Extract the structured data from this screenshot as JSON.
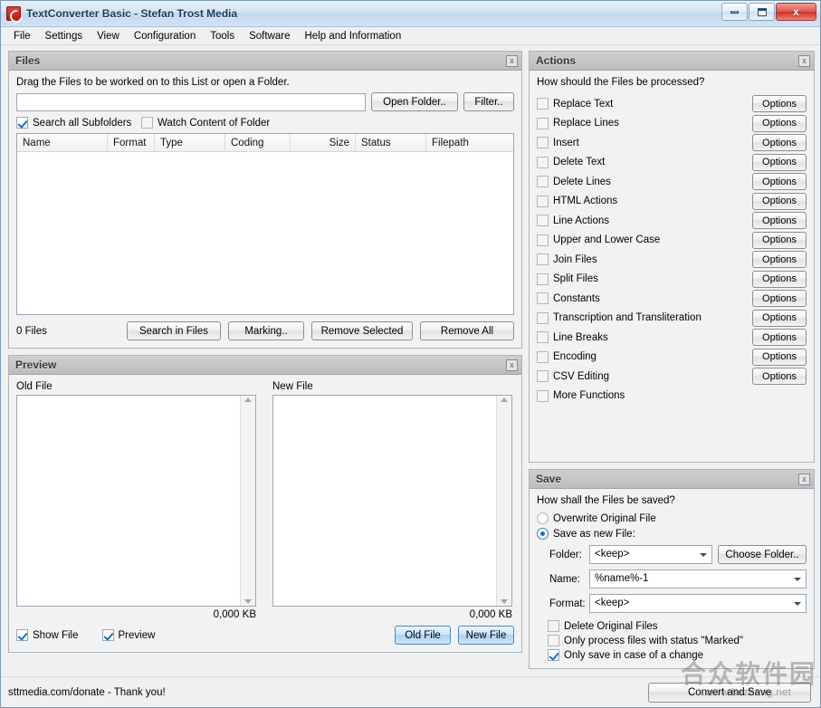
{
  "window": {
    "title": "TextConverter Basic - Stefan Trost Media",
    "app_icon": "refresh-circle-icon",
    "controls": {
      "minimize": "minimize-icon",
      "maximize": "maximize-icon",
      "close": "x"
    }
  },
  "menubar": {
    "items": [
      "File",
      "Settings",
      "View",
      "Configuration",
      "Tools",
      "Software",
      "Help and Information"
    ]
  },
  "files": {
    "title": "Files",
    "close_icon": "x",
    "hint": "Drag the Files to be worked on to this List or open a Folder.",
    "path_value": "",
    "path_placeholder": "",
    "open_folder_button": "Open Folder..",
    "filter_button": "Filter..",
    "search_subfolders": {
      "label": "Search all Subfolders",
      "checked": true
    },
    "watch_content": {
      "label": "Watch Content of Folder",
      "checked": false
    },
    "columns": [
      "Name",
      "Format",
      "Type",
      "Coding",
      "Size",
      "Status",
      "Filepath"
    ],
    "rows": [],
    "count_label": "0 Files",
    "buttons": [
      "Search in Files",
      "Marking..",
      "Remove Selected",
      "Remove All"
    ]
  },
  "preview": {
    "title": "Preview",
    "close_icon": "x",
    "old_label": "Old File",
    "new_label": "New File",
    "old_text": "",
    "new_text": "",
    "old_size": "0,000 KB",
    "new_size": "0,000 KB",
    "show_file": {
      "label": "Show File",
      "checked": true
    },
    "preview_toggle": {
      "label": "Preview",
      "checked": true
    },
    "old_file_button": "Old File",
    "new_file_button": "New File"
  },
  "actions": {
    "title": "Actions",
    "close_icon": "x",
    "hint": "How should the Files be processed?",
    "options_label": "Options",
    "items": [
      {
        "label": "Replace Text",
        "checked": false,
        "has_options": true
      },
      {
        "label": "Replace Lines",
        "checked": false,
        "has_options": true
      },
      {
        "label": "Insert",
        "checked": false,
        "has_options": true
      },
      {
        "label": "Delete Text",
        "checked": false,
        "has_options": true
      },
      {
        "label": "Delete Lines",
        "checked": false,
        "has_options": true
      },
      {
        "label": "HTML Actions",
        "checked": false,
        "has_options": true
      },
      {
        "label": "Line Actions",
        "checked": false,
        "has_options": true
      },
      {
        "label": "Upper and Lower Case",
        "checked": false,
        "has_options": true
      },
      {
        "label": "Join Files",
        "checked": false,
        "has_options": true
      },
      {
        "label": "Split Files",
        "checked": false,
        "has_options": true
      },
      {
        "label": "Constants",
        "checked": false,
        "has_options": true
      },
      {
        "label": "Transcription and Transliteration",
        "checked": false,
        "has_options": true
      },
      {
        "label": "Line Breaks",
        "checked": false,
        "has_options": true
      },
      {
        "label": "Encoding",
        "checked": false,
        "has_options": true
      },
      {
        "label": "CSV Editing",
        "checked": false,
        "has_options": true
      },
      {
        "label": "More Functions",
        "checked": false,
        "has_options": false
      }
    ]
  },
  "save": {
    "title": "Save",
    "close_icon": "x",
    "hint": "How shall the Files be saved?",
    "overwrite": {
      "label": "Overwrite Original File",
      "selected": false
    },
    "save_as_new": {
      "label": "Save as new File:",
      "selected": true
    },
    "folder_label": "Folder:",
    "folder_value": "<keep>",
    "choose_folder_button": "Choose Folder..",
    "name_label": "Name:",
    "name_value": "%name%-1",
    "format_label": "Format:",
    "format_value": "<keep>",
    "delete_originals": {
      "label": "Delete Original Files",
      "checked": false
    },
    "only_marked": {
      "label": "Only process files with status \"Marked\"",
      "checked": false
    },
    "only_on_change": {
      "label": "Only save in case of a change",
      "checked": true
    }
  },
  "statusbar": {
    "text": "sttmedia.com/donate - Thank you!",
    "convert_button": "Convert and Save"
  },
  "watermark": {
    "chinese": "合众软件园",
    "url": "www.hezhong.net"
  }
}
